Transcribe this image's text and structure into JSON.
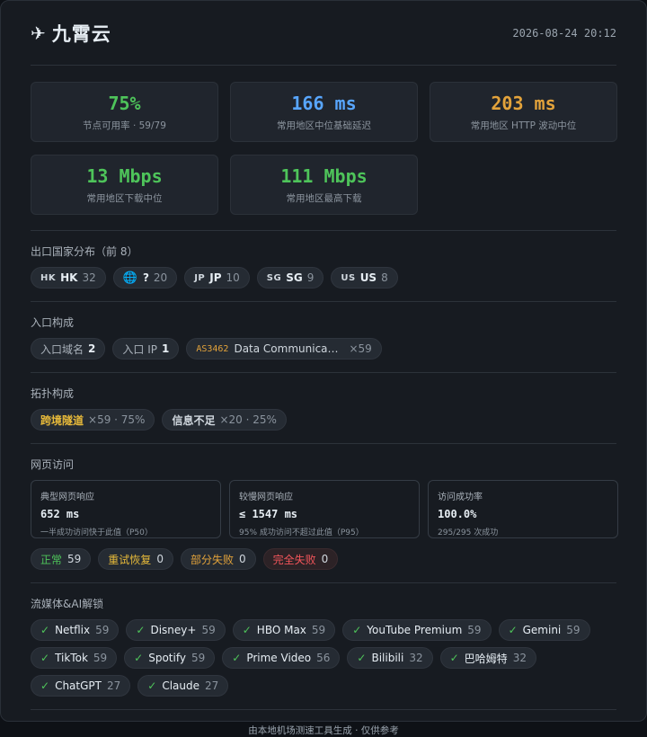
{
  "header": {
    "title": "九霄云",
    "timestamp": "2026-08-24 20:12"
  },
  "stats": [
    {
      "value": "75%",
      "label": "节点可用率 · 59/79",
      "color": "green"
    },
    {
      "value": "166 ms",
      "label": "常用地区中位基础延迟",
      "color": "blue"
    },
    {
      "value": "203 ms",
      "label": "常用地区 HTTP 波动中位",
      "color": "orange"
    },
    {
      "value": "13 Mbps",
      "label": "常用地区下载中位",
      "color": "green"
    },
    {
      "value": "111 Mbps",
      "label": "常用地区最高下载",
      "color": "green"
    }
  ],
  "exit_countries": {
    "title": "出口国家分布（前 8）",
    "items": [
      {
        "flag": "HK",
        "code": "HK",
        "count": "32"
      },
      {
        "flag": "globe",
        "code": "?",
        "count": "20"
      },
      {
        "flag": "JP",
        "code": "JP",
        "count": "10"
      },
      {
        "flag": "SG",
        "code": "SG",
        "count": "9"
      },
      {
        "flag": "US",
        "code": "US",
        "count": "8"
      }
    ]
  },
  "entry": {
    "title": "入口构成",
    "domain_label": "入口域名",
    "domain_count": "2",
    "ip_label": "入口 IP",
    "ip_count": "1",
    "asn": "AS3462",
    "asn_name": "Data Communication Business Group",
    "asn_count": "×59"
  },
  "topology": {
    "title": "拓扑构成",
    "items": [
      {
        "name": "跨境隧道",
        "detail": "×59 · 75%",
        "tone": "yellow"
      },
      {
        "name": "信息不足",
        "detail": "×20 · 25%",
        "tone": "plain"
      }
    ]
  },
  "web": {
    "title": "网页访问",
    "boxes": [
      {
        "title": "典型网页响应",
        "value": "652 ms",
        "sub": "一半成功访问快于此值（P50）"
      },
      {
        "title": "较慢网页响应",
        "value": "≤ 1547 ms",
        "sub": "95% 成功访问不超过此值（P95）"
      },
      {
        "title": "访问成功率",
        "value": "100.0%",
        "sub": "295/295 次成功"
      }
    ],
    "statuses": [
      {
        "label": "正常",
        "count": "59",
        "tone": "green"
      },
      {
        "label": "重试恢复",
        "count": "0",
        "tone": "yellow"
      },
      {
        "label": "部分失败",
        "count": "0",
        "tone": "orange"
      },
      {
        "label": "完全失败",
        "count": "0",
        "tone": "red"
      }
    ]
  },
  "media": {
    "title": "流媒体&AI解锁",
    "check": "✓",
    "items": [
      {
        "name": "Netflix",
        "count": "59"
      },
      {
        "name": "Disney+",
        "count": "59"
      },
      {
        "name": "HBO Max",
        "count": "59"
      },
      {
        "name": "YouTube Premium",
        "count": "59"
      },
      {
        "name": "Gemini",
        "count": "59"
      },
      {
        "name": "TikTok",
        "count": "59"
      },
      {
        "name": "Spotify",
        "count": "59"
      },
      {
        "name": "Prime Video",
        "count": "56"
      },
      {
        "name": "Bilibili",
        "count": "32"
      },
      {
        "name": "巴哈姆特",
        "count": "32"
      },
      {
        "name": "ChatGPT",
        "count": "27"
      },
      {
        "name": "Claude",
        "count": "27"
      }
    ]
  },
  "footer": "由本地机场测速工具生成 · 仅供参考"
}
